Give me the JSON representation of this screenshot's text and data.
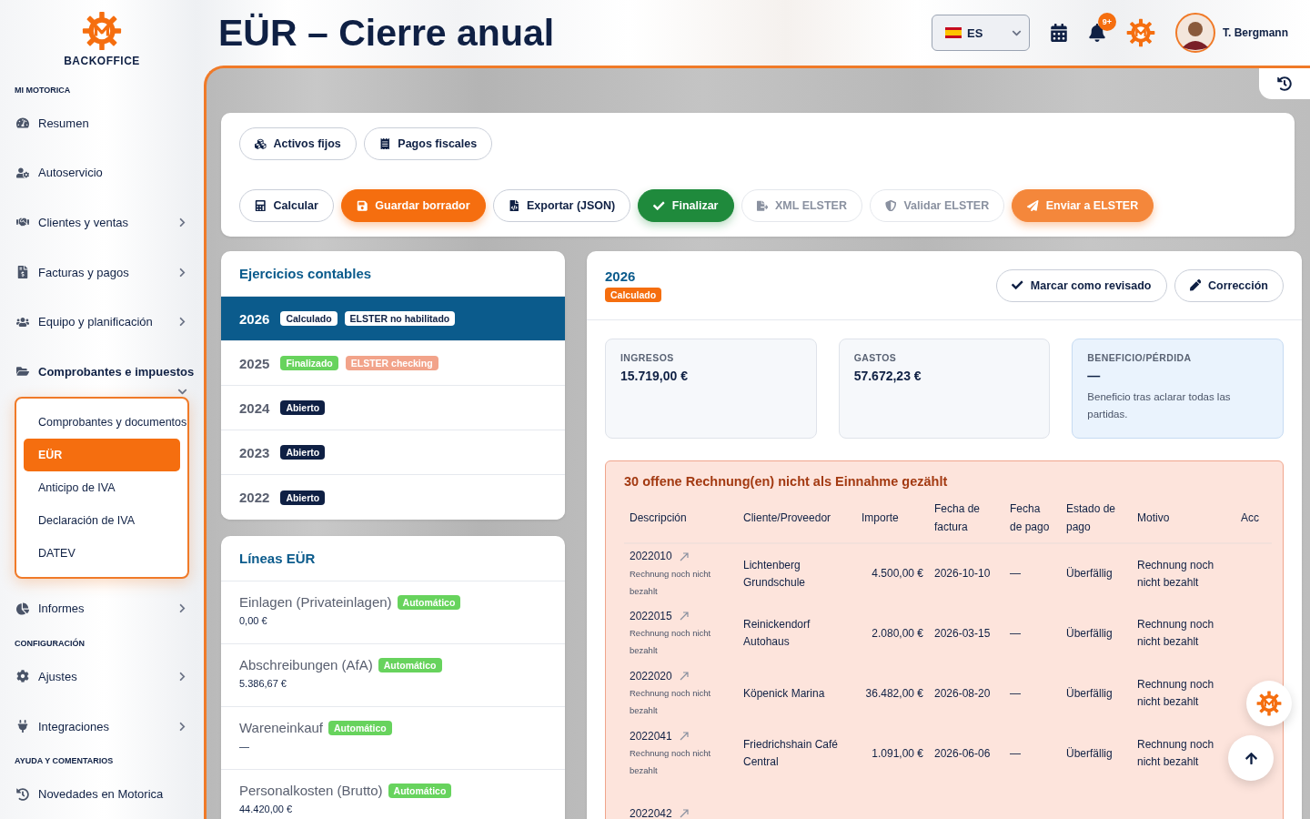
{
  "brand": {
    "name": "BACKOFFICE"
  },
  "sidebar": {
    "sections": [
      {
        "title": "MI MOTORICA",
        "items": [
          {
            "label": "Resumen",
            "expandable": false,
            "expanded": false
          },
          {
            "label": "Autoservicio",
            "expandable": false,
            "expanded": false
          },
          {
            "label": "Clientes y ventas",
            "expandable": true,
            "expanded": false
          },
          {
            "label": "Facturas y pagos",
            "expandable": true,
            "expanded": false
          },
          {
            "label": "Equipo y planificación",
            "expandable": true,
            "expanded": false
          },
          {
            "label": "Comprobantes e impuestos",
            "expandable": true,
            "expanded": true,
            "children": [
              {
                "label": "Comprobantes y documentos",
                "selected": false
              },
              {
                "label": "EÜR",
                "selected": true
              },
              {
                "label": "Anticipo de IVA",
                "selected": false
              },
              {
                "label": "Declaración de IVA",
                "selected": false
              },
              {
                "label": "DATEV",
                "selected": false
              }
            ]
          },
          {
            "label": "Informes",
            "expandable": true,
            "expanded": false
          }
        ]
      },
      {
        "title": "CONFIGURACIÓN",
        "items": [
          {
            "label": "Ajustes",
            "expandable": true,
            "expanded": false
          },
          {
            "label": "Integraciones",
            "expandable": true,
            "expanded": false
          }
        ]
      },
      {
        "title": "AYUDA Y COMENTARIOS",
        "items": [
          {
            "label": "Novedades en Motorica",
            "expandable": false,
            "expanded": false
          }
        ]
      }
    ]
  },
  "page": {
    "title": "EÜR – Cierre anual"
  },
  "topbar": {
    "language": "ES",
    "notifications": "9+",
    "user": "T. Bergmann"
  },
  "toolbar": {
    "rows": [
      [
        {
          "label": "Activos fijos",
          "kind": "outline"
        },
        {
          "label": "Pagos fiscales",
          "kind": "outline"
        }
      ],
      [
        {
          "label": "Calcular",
          "kind": "outline"
        },
        {
          "label": "Guardar borrador",
          "kind": "primary"
        },
        {
          "label": "Exportar (JSON)",
          "kind": "outline"
        },
        {
          "label": "Finalizar",
          "kind": "success"
        },
        {
          "label": "XML ELSTER",
          "kind": "disabled"
        },
        {
          "label": "Validar ELSTER",
          "kind": "disabled"
        },
        {
          "label": "Enviar a ELSTER",
          "kind": "accent"
        }
      ]
    ]
  },
  "years": {
    "title": "Ejercicios contables",
    "items": [
      {
        "year": "2026",
        "selected": true,
        "badges": [
          {
            "label": "Calculado",
            "kind": "calculated"
          },
          {
            "label": "ELSTER no habilitado",
            "kind": "elster_off"
          }
        ]
      },
      {
        "year": "2025",
        "selected": false,
        "badges": [
          {
            "label": "Finalizado",
            "kind": "finalized"
          },
          {
            "label": "ELSTER checking",
            "kind": "elster_checking"
          }
        ]
      },
      {
        "year": "2024",
        "selected": false,
        "badges": [
          {
            "label": "Abierto",
            "kind": "open"
          }
        ]
      },
      {
        "year": "2023",
        "selected": false,
        "badges": [
          {
            "label": "Abierto",
            "kind": "open"
          }
        ]
      },
      {
        "year": "2022",
        "selected": false,
        "badges": [
          {
            "label": "Abierto",
            "kind": "open"
          }
        ]
      }
    ]
  },
  "lines": {
    "title": "Líneas EÜR",
    "items": [
      {
        "label": "Einlagen (Privateinlagen)",
        "badge": "Automático",
        "value": "0,00 €"
      },
      {
        "label": "Abschreibungen (AfA)",
        "badge": "Automático",
        "value": "5.386,67 €"
      },
      {
        "label": "Wareneinkauf",
        "badge": "Automático",
        "value": "—"
      },
      {
        "label": "Personalkosten (Brutto)",
        "badge": "Automático",
        "value": "44.420,00 €"
      }
    ]
  },
  "detail": {
    "year": "2026",
    "status": "Calculado",
    "actions": [
      {
        "label": "Marcar como revisado"
      },
      {
        "label": "Corrección"
      }
    ],
    "stats": [
      {
        "label": "INGRESOS",
        "value": "15.719,00 €",
        "highlight": false
      },
      {
        "label": "GASTOS",
        "value": "57.672,23 €",
        "highlight": false
      },
      {
        "label": "BENEFICIO/PÉRDIDA",
        "value": "—",
        "note": "Beneficio tras aclarar todas las partidas.",
        "highlight": true
      }
    ],
    "alert": {
      "title": "30 offene Rechnung(en) nicht als Einnahme gezählt",
      "table": {
        "columns": [
          "Descripción",
          "Cliente/Proveedor",
          "Importe",
          "Fecha de factura",
          "Fecha de pago",
          "Estado de pago",
          "Motivo",
          "Acc"
        ],
        "rows": [
          {
            "number": "2022010",
            "note": "Rechnung noch nicht bezahlt",
            "client": "Lichtenberg Grundschule",
            "amount": "4.500,00 €",
            "invoice_date": "2026-10-10",
            "payment_date": "—",
            "status": "Überfällig",
            "reason": "Rechnung noch nicht bezahlt"
          },
          {
            "number": "2022015",
            "note": "Rechnung noch nicht bezahlt",
            "client": "Reinickendorf Autohaus",
            "amount": "2.080,00 €",
            "invoice_date": "2026-03-15",
            "payment_date": "—",
            "status": "Überfällig",
            "reason": "Rechnung noch nicht bezahlt"
          },
          {
            "number": "2022020",
            "note": "Rechnung noch nicht bezahlt",
            "client": "Köpenick Marina",
            "amount": "36.482,00 €",
            "invoice_date": "2026-08-20",
            "payment_date": "—",
            "status": "Überfällig",
            "reason": "Rechnung noch nicht bezahlt"
          },
          {
            "number": "2022041",
            "note": "Rechnung noch nicht bezahlt",
            "client": "Friedrichshain Café Central",
            "amount": "1.091,00 €",
            "invoice_date": "2026-06-06",
            "payment_date": "—",
            "status": "Überfällig",
            "reason": "Rechnung noch nicht bezahlt"
          },
          {
            "number": "2022042"
          }
        ]
      }
    }
  }
}
